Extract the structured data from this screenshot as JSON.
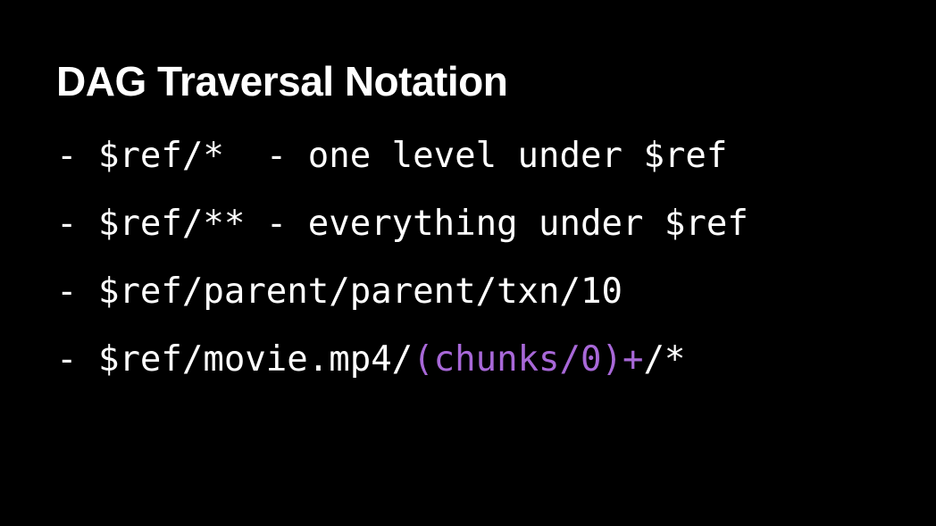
{
  "slide": {
    "title": "DAG Traversal Notation",
    "bullets": [
      {
        "text": "- $ref/*  - one level under $ref"
      },
      {
        "text": "- $ref/** - everything under $ref"
      },
      {
        "text": "- $ref/parent/parent/txn/10"
      },
      {
        "prefix": "- $ref/movie.mp4/",
        "highlight": "(chunks/0)+",
        "suffix": "/*"
      }
    ]
  },
  "colors": {
    "background": "#000000",
    "text": "#ffffff",
    "highlight": "#a868d8"
  }
}
